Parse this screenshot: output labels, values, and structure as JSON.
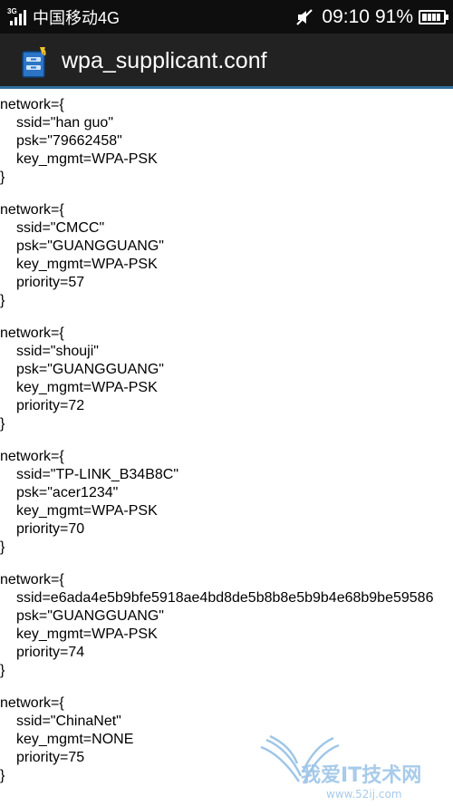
{
  "status_bar": {
    "network_tag": "3G",
    "carrier": "中国移动4G",
    "time": "09:10",
    "battery_percent": "91%",
    "battery_level": 0.91
  },
  "title_bar": {
    "title": "wpa_supplicant.conf",
    "icon": "file-cabinet-icon"
  },
  "file": {
    "networks": [
      {
        "open": "network={",
        "close": "}",
        "fields": [
          "ssid=\"han guo\"",
          "psk=\"79662458\"",
          "key_mgmt=WPA-PSK"
        ]
      },
      {
        "open": "network={",
        "close": "}",
        "fields": [
          "ssid=\"CMCC\"",
          "psk=\"GUANGGUANG\"",
          "key_mgmt=WPA-PSK",
          "priority=57"
        ]
      },
      {
        "open": "network={",
        "close": "}",
        "fields": [
          "ssid=\"shouji\"",
          "psk=\"GUANGGUANG\"",
          "key_mgmt=WPA-PSK",
          "priority=72"
        ]
      },
      {
        "open": "network={",
        "close": "}",
        "fields": [
          "ssid=\"TP-LINK_B34B8C\"",
          "psk=\"acer1234\"",
          "key_mgmt=WPA-PSK",
          "priority=70"
        ]
      },
      {
        "open": "network={",
        "close": "}",
        "fields": [
          "ssid=e6ada4e5b9bfe5918ae4bd8de5b8b8e5b9b4e68b9be59586",
          "psk=\"GUANGGUANG\"",
          "key_mgmt=WPA-PSK",
          "priority=74"
        ]
      },
      {
        "open": "network={",
        "close": "}",
        "fields": [
          "ssid=\"ChinaNet\"",
          "key_mgmt=NONE",
          "priority=75"
        ]
      }
    ]
  },
  "watermark": {
    "text": "我爱IT技术网",
    "url": "www.52ij.com"
  },
  "colors": {
    "status_bar_bg": "#0e0e0e",
    "title_bar_bg": "#222222",
    "title_underline": "#2f6f9e",
    "watermark": "#9fc6e8"
  }
}
